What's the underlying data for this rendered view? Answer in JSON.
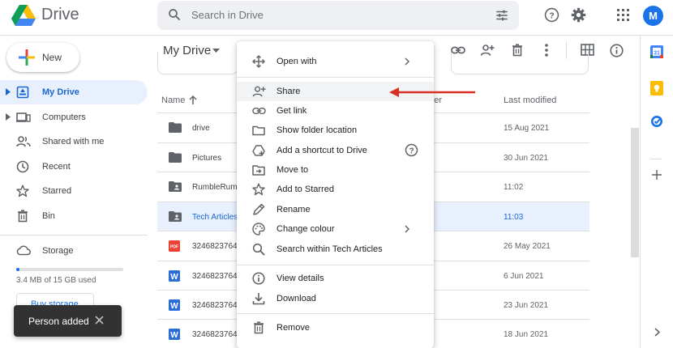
{
  "app": {
    "title": "Drive",
    "user_initial": "M"
  },
  "search": {
    "placeholder": "Search in Drive"
  },
  "sidebar": {
    "new_label": "New",
    "items": [
      {
        "label": "My Drive",
        "icon": "my-drive-icon",
        "active": true
      },
      {
        "label": "Computers",
        "icon": "computers-icon"
      },
      {
        "label": "Shared with me",
        "icon": "shared-with-me-icon"
      },
      {
        "label": "Recent",
        "icon": "clock-icon"
      },
      {
        "label": "Starred",
        "icon": "star-icon"
      },
      {
        "label": "Bin",
        "icon": "bin-icon"
      },
      {
        "label": "Storage",
        "icon": "cloud-icon"
      }
    ],
    "storage_used_fraction": 0.0227,
    "storage_text": "3.4 MB of 15 GB used",
    "buy_storage": "Buy storage"
  },
  "toast": {
    "message": "Person added"
  },
  "main": {
    "location": "My Drive",
    "columns": {
      "name": "Name",
      "owner": "Owner",
      "modified": "Last modified"
    },
    "files": [
      {
        "name": "drive",
        "type": "folder",
        "modified": "15 Aug 2021"
      },
      {
        "name": "Pictures",
        "type": "folder",
        "modified": "30 Jun 2021"
      },
      {
        "name": "RumbleRum",
        "type": "shared-folder",
        "modified": "11:02"
      },
      {
        "name": "Tech Articles",
        "type": "shared-folder",
        "modified": "11:03",
        "selected": true
      },
      {
        "name": "3246823764",
        "type": "pdf",
        "modified": "26 May 2021"
      },
      {
        "name": "3246823764",
        "type": "word",
        "modified": "6 Jun 2021"
      },
      {
        "name": "3246823764",
        "type": "word",
        "modified": "23 Jun 2021"
      },
      {
        "name": "3246823764",
        "type": "word",
        "modified": "18 Jun 2021"
      }
    ]
  },
  "context_menu": {
    "open_with": "Open with",
    "share": "Share",
    "get_link": "Get link",
    "show_folder_location": "Show folder location",
    "add_shortcut": "Add a shortcut to Drive",
    "move_to": "Move to",
    "add_to_starred": "Add to Starred",
    "rename": "Rename",
    "change_colour": "Change colour",
    "search_within": "Search within Tech Articles",
    "view_details": "View details",
    "download": "Download",
    "remove": "Remove"
  },
  "colors": {
    "accent": "#1a73e8",
    "selected_bg": "#e8f0fe",
    "annotation_arrow": "#d93025"
  }
}
